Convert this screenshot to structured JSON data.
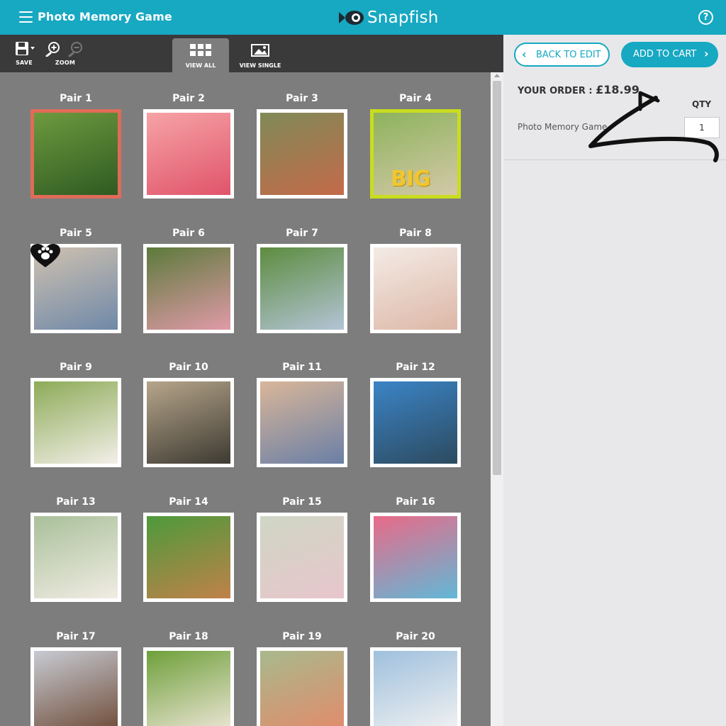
{
  "header": {
    "title": "Photo Memory Game",
    "brand": "Snapfish",
    "help_symbol": "?",
    "color": "#17a8c2"
  },
  "toolbar": {
    "save_label": "SAVE",
    "zoom_label": "ZOOM",
    "tabs": [
      {
        "label": "VIEW ALL",
        "active": true
      },
      {
        "label": "VIEW SINGLE",
        "active": false
      }
    ]
  },
  "pairs": [
    {
      "label": "Pair 1",
      "frame_color": "#e06b58",
      "colors": [
        "#6d9a3e",
        "#2f5a22"
      ]
    },
    {
      "label": "Pair 2",
      "frame_color": "#ffffff",
      "colors": [
        "#f6a3a6",
        "#e0546a"
      ]
    },
    {
      "label": "Pair 3",
      "frame_color": "#ffffff",
      "colors": [
        "#7f8a57",
        "#c46a4a"
      ]
    },
    {
      "label": "Pair 4",
      "frame_color": "#c9dd1e",
      "colors": [
        "#8db35c",
        "#d4c8a8"
      ],
      "overlay": "BIG"
    },
    {
      "label": "Pair 5",
      "frame_color": "#ffffff",
      "colors": [
        "#cfc1b0",
        "#6f89a8"
      ],
      "badge": "paw-heart"
    },
    {
      "label": "Pair 6",
      "frame_color": "#ffffff",
      "colors": [
        "#5c7a3b",
        "#e09aa8"
      ]
    },
    {
      "label": "Pair 7",
      "frame_color": "#ffffff",
      "colors": [
        "#5d8c3f",
        "#b3c4d6"
      ]
    },
    {
      "label": "Pair 8",
      "frame_color": "#ffffff",
      "colors": [
        "#f4ebe6",
        "#dcb7a6"
      ]
    },
    {
      "label": "Pair 9",
      "frame_color": "#ffffff",
      "colors": [
        "#8dab58",
        "#f3efe8"
      ]
    },
    {
      "label": "Pair 10",
      "frame_color": "#ffffff",
      "colors": [
        "#b6a58a",
        "#3d3a32"
      ]
    },
    {
      "label": "Pair 11",
      "frame_color": "#ffffff",
      "colors": [
        "#d9b699",
        "#6a7fa6"
      ]
    },
    {
      "label": "Pair 12",
      "frame_color": "#ffffff",
      "colors": [
        "#3b84c6",
        "#2c4a5f"
      ]
    },
    {
      "label": "Pair 13",
      "frame_color": "#ffffff",
      "colors": [
        "#a9c09a",
        "#f1ece4"
      ]
    },
    {
      "label": "Pair 14",
      "frame_color": "#ffffff",
      "colors": [
        "#4d9a3b",
        "#c0814a"
      ]
    },
    {
      "label": "Pair 15",
      "frame_color": "#ffffff",
      "colors": [
        "#cfd7c5",
        "#e8c6cc"
      ]
    },
    {
      "label": "Pair 16",
      "frame_color": "#ffffff",
      "colors": [
        "#e96a88",
        "#61b8d6"
      ]
    },
    {
      "label": "Pair 17",
      "frame_color": "#ffffff",
      "colors": [
        "#c7cbd3",
        "#6e4a36"
      ]
    },
    {
      "label": "Pair 18",
      "frame_color": "#ffffff",
      "colors": [
        "#6ea03a",
        "#efe6d8"
      ]
    },
    {
      "label": "Pair 19",
      "frame_color": "#ffffff",
      "colors": [
        "#a8b98d",
        "#e38a6a"
      ]
    },
    {
      "label": "Pair 20",
      "frame_color": "#ffffff",
      "colors": [
        "#9fc0dd",
        "#f2f2f2"
      ]
    }
  ],
  "order": {
    "back_label": "BACK TO EDIT",
    "cart_label": "ADD TO CART",
    "your_order_label": "YOUR ORDER :",
    "price": "£18.99",
    "qty_label": "QTY",
    "item_name": "Photo Memory Game",
    "qty_value": "1"
  }
}
